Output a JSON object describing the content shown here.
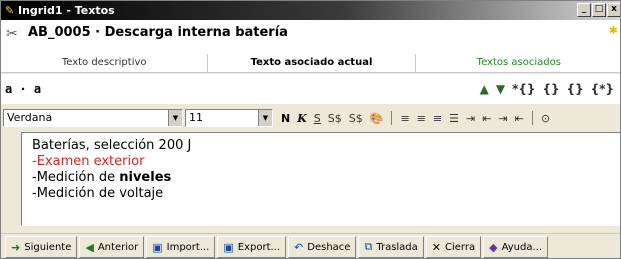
{
  "window": {
    "title": "Ingrid1 - Textos",
    "title_icon": "app-icon",
    "controls": [
      "_",
      "□",
      "x"
    ]
  },
  "header": {
    "icon": "ingrid-icon",
    "title": "AB_0005 · Descarga interna batería"
  },
  "tabs": [
    {
      "label": "Texto descriptivo"
    },
    {
      "label": "Texto asociado actual"
    },
    {
      "label": "Textos asociados"
    }
  ],
  "subbar": {
    "ref": "a · a",
    "nav_icons": [
      "up-arrow-icon",
      "down-arrow-icon",
      "braces-insert-icon",
      "braces-left-icon",
      "braces-right-icon",
      "braces-special-icon"
    ]
  },
  "format": {
    "font": "Verdana",
    "size": "11",
    "buttons": [
      "N",
      "K",
      "S",
      "S$",
      "S$",
      "🎨"
    ],
    "align_icons": [
      "align-left-icon",
      "align-center-icon",
      "align-right-icon",
      "list-icon",
      "indent-icon",
      "outdent-icon",
      "indent2-icon",
      "outdent2-icon",
      "attach-icon"
    ]
  },
  "editor": {
    "lines": {
      "line1": "Baterías, selección 200 J",
      "line2": "-Examen exterior",
      "line3_prefix": "-Medición de ",
      "line3_bold": "niveles",
      "line4": "-Medición de voltaje"
    }
  },
  "buttons": {
    "siguiente": "Siguiente",
    "anterior": "Anterior",
    "import": "Import...",
    "export": "Export...",
    "deshace": "Deshace",
    "traslada": "Traslada",
    "cierra": "Cierra",
    "ayuda": "Ayuda..."
  }
}
